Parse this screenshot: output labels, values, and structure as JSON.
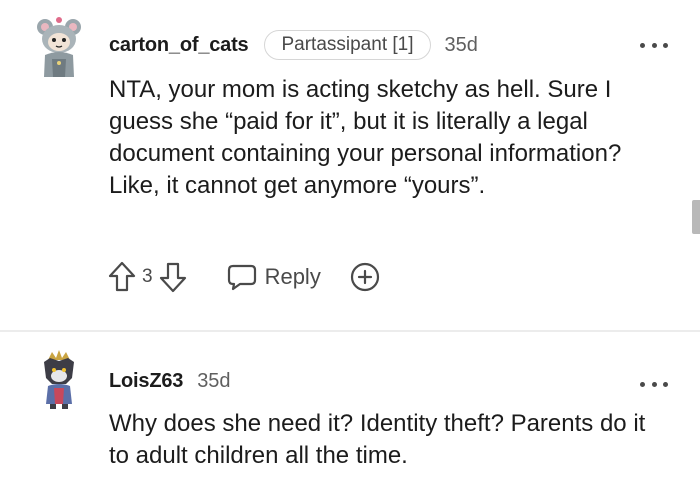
{
  "comments": [
    {
      "username": "carton_of_cats",
      "flair": "Partassipant [1]",
      "timestamp": "35d",
      "body": "NTA, your mom is acting sketchy as hell. Sure I guess she “paid for it”, but it is literally a legal document containing your personal information? Like, it cannot get anymore “yours”.",
      "votes": "3",
      "reply_label": "Reply",
      "avatar_icon": "cat-costume-avatar-icon"
    },
    {
      "username": "LoisZ63",
      "timestamp": "35d",
      "body": "Why does she need it? Identity theft? Parents do it to adult children all the time.",
      "avatar_icon": "wolf-crown-avatar-icon"
    }
  ],
  "colors": {
    "text": "#1c1c1c",
    "muted": "#5f5f5f",
    "icon": "#4a4a4a",
    "divider": "#ececec"
  }
}
